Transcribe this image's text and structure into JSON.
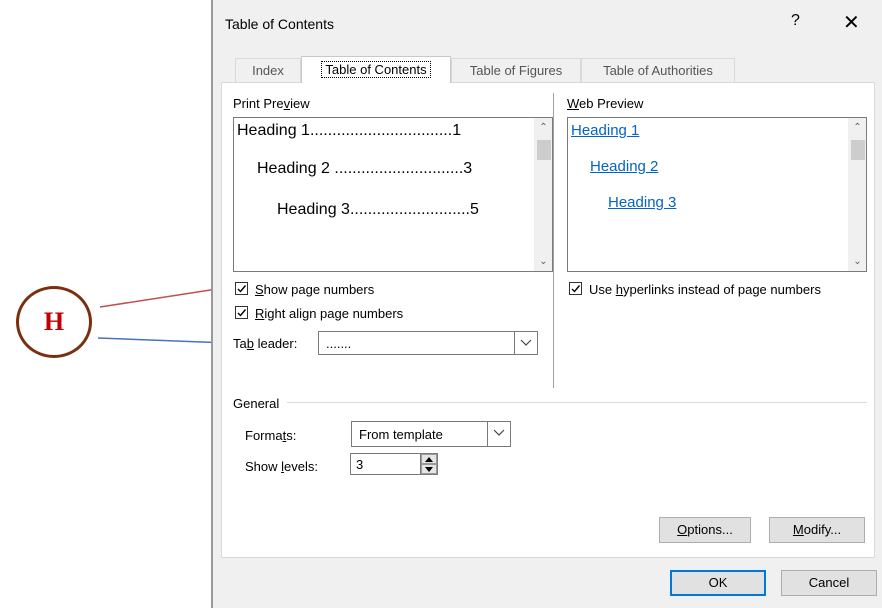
{
  "annotation": {
    "marker_label": "H",
    "arrow_top_color": "#c0504d",
    "arrow_bottom_color": "#4472c4"
  },
  "dialog": {
    "title": "Table of Contents",
    "help_glyph": "?",
    "close_glyph": "✕",
    "tabs": [
      {
        "label": "Index",
        "active": false
      },
      {
        "label": "Table of Contents",
        "active": true
      },
      {
        "label": "Table of Figures",
        "active": false
      },
      {
        "label": "Table of Authorities",
        "active": false
      }
    ],
    "print_preview": {
      "label": "Print Preview",
      "lines": [
        {
          "text": "Heading 1................................1"
        },
        {
          "text": "Heading 2 .............................3"
        },
        {
          "text": "Heading 3...........................5"
        }
      ]
    },
    "web_preview": {
      "label": "Web Preview",
      "links": [
        "Heading 1",
        "Heading 2",
        "Heading 3"
      ]
    },
    "show_page_numbers": {
      "label": "Show page numbers",
      "checked": true
    },
    "right_align": {
      "label": "Right align page numbers",
      "checked": true
    },
    "use_hyperlinks": {
      "label": "Use hyperlinks instead of page numbers",
      "checked": true
    },
    "tab_leader": {
      "label": "Tab leader:",
      "value": "......."
    },
    "general": {
      "label": "General",
      "formats_label": "Formats:",
      "formats_value": "From template",
      "show_levels_label": "Show levels:",
      "show_levels_value": "3"
    },
    "buttons": {
      "options": "Options...",
      "modify": "Modify...",
      "ok": "OK",
      "cancel": "Cancel"
    }
  }
}
